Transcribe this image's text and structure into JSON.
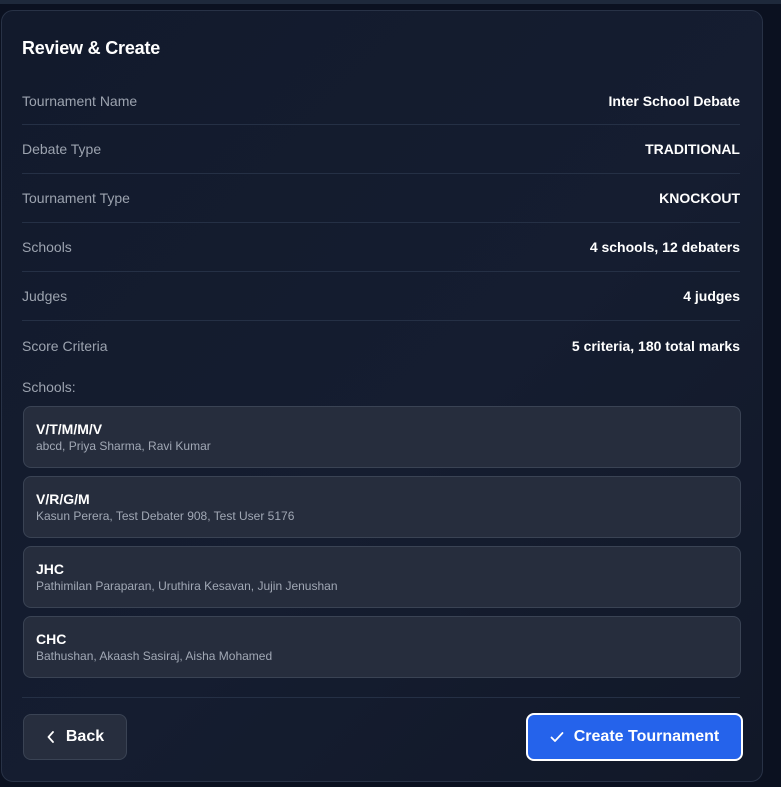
{
  "panel": {
    "title": "Review & Create"
  },
  "summary": [
    {
      "label": "Tournament Name",
      "value": "Inter School Debate"
    },
    {
      "label": "Debate Type",
      "value": "TRADITIONAL"
    },
    {
      "label": "Tournament Type",
      "value": "KNOCKOUT"
    },
    {
      "label": "Schools",
      "value": "4 schools, 12 debaters"
    },
    {
      "label": "Judges",
      "value": "4 judges"
    },
    {
      "label": "Score Criteria",
      "value": "5 criteria, 180 total marks"
    }
  ],
  "schools_heading": "Schools:",
  "schools": [
    {
      "name": "V/T/M/M/V",
      "members": "abcd, Priya Sharma, Ravi Kumar"
    },
    {
      "name": "V/R/G/M",
      "members": "Kasun Perera, Test Debater 908, Test User 5176"
    },
    {
      "name": "JHC",
      "members": "Pathimilan Paraparan, Uruthira Kesavan, Jujin Jenushan"
    },
    {
      "name": "CHC",
      "members": "Bathushan, Akaash Sasiraj, Aisha Mohamed"
    }
  ],
  "actions": {
    "back_label": "Back",
    "back_icon": "chevron-left-icon",
    "create_label": "Create Tournament",
    "create_icon": "check-icon"
  },
  "colors": {
    "background": "#0b1120",
    "card": "#131b2d",
    "accent": "#2563eb"
  }
}
